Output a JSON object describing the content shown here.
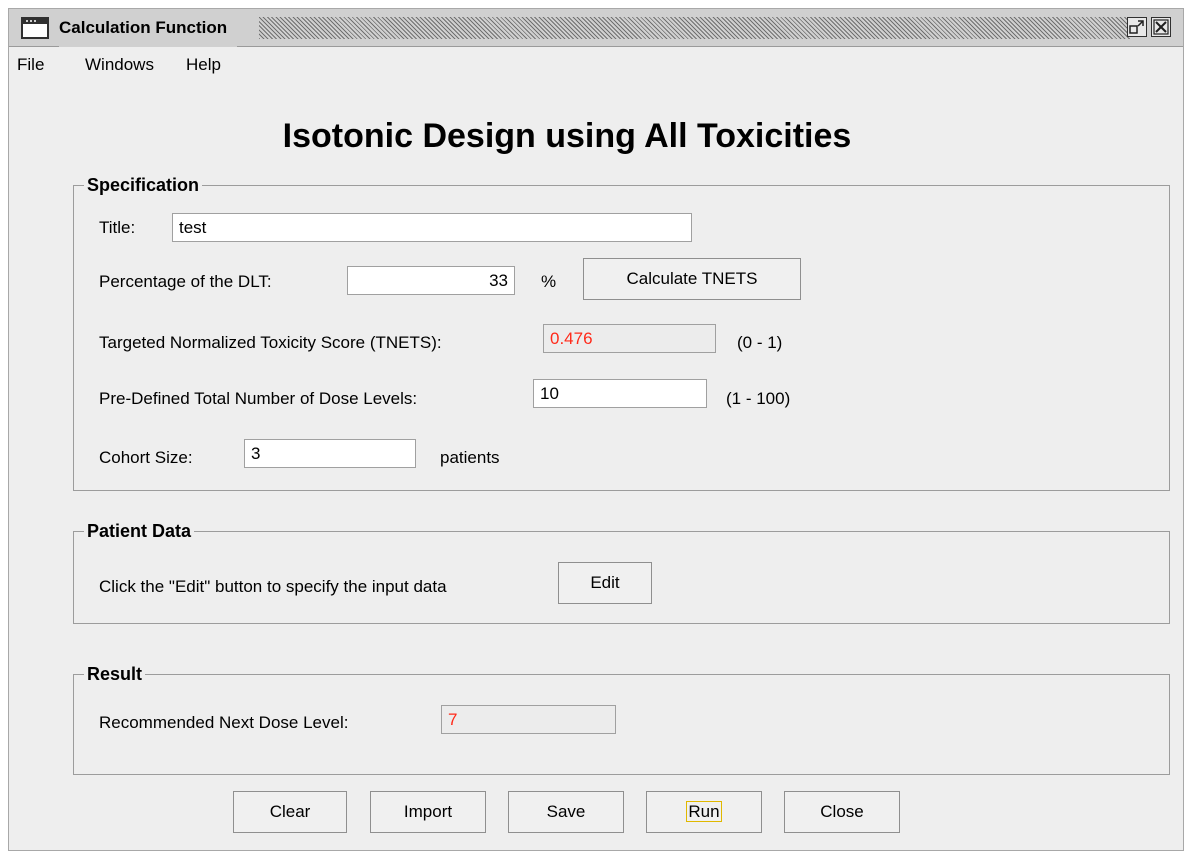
{
  "window": {
    "title": "Calculation Function"
  },
  "menu": [
    "File",
    "Windows",
    "Help"
  ],
  "heading": "Isotonic Design using All Toxicities",
  "specification": {
    "legend": "Specification",
    "title_label": "Title:",
    "title_value": "test",
    "dlt_label": "Percentage of the DLT:",
    "dlt_value": "33",
    "dlt_unit": "%",
    "calculate_button": "Calculate TNETS",
    "tnets_label": "Targeted Normalized Toxicity Score (TNETS):",
    "tnets_value": "0.476",
    "tnets_range": "(0 - 1)",
    "dose_levels_label": "Pre-Defined Total Number of Dose Levels:",
    "dose_levels_value": "10",
    "dose_levels_range": "(1 - 100)",
    "cohort_label": "Cohort Size:",
    "cohort_value": "3",
    "cohort_unit": "patients"
  },
  "patient_data": {
    "legend": "Patient Data",
    "instruction": "Click the \"Edit\" button to specify the input data",
    "edit_button": "Edit"
  },
  "result": {
    "legend": "Result",
    "next_dose_label": "Recommended Next Dose Level:",
    "next_dose_value": "7"
  },
  "buttons": {
    "clear": "Clear",
    "import": "Import",
    "save": "Save",
    "run": "Run",
    "close": "Close"
  },
  "colors": {
    "window_bg": "#eeeeee",
    "result_value_text": "#ff2a1a",
    "focus_outline": "#e0b800"
  },
  "icons": [
    "window-app-icon",
    "restore-icon",
    "close-icon"
  ]
}
